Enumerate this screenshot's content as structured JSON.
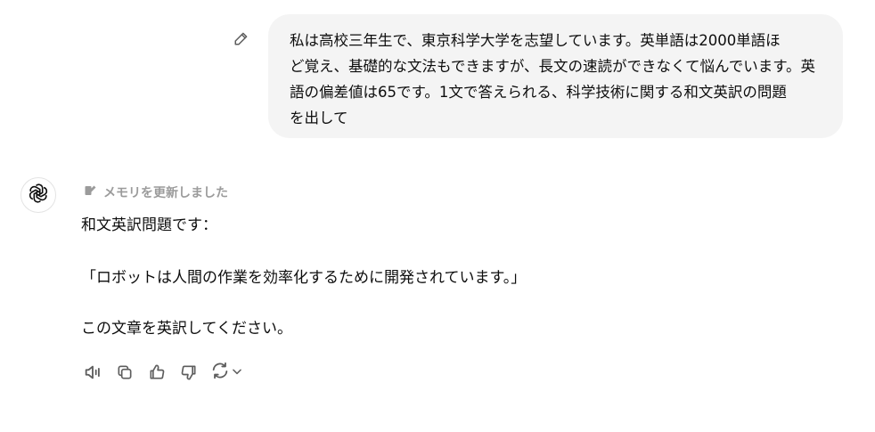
{
  "user_message": {
    "lines": [
      "私は高校三年生で、東京科学大学を志望しています。英単語は2000単語ほ",
      "ど覚え、基礎的な文法もできますが、長文の速読ができなくて悩んでいます。英",
      "語の偏差値は65です。1文で答えられる、科学技術に関する和文英訳の問題",
      "を出して"
    ],
    "edit_icon": "pencil-icon"
  },
  "assistant": {
    "avatar_icon": "openai-logo",
    "memory_note": "メモリを更新しました",
    "memory_icon": "memory-edit-icon",
    "lines": {
      "intro": "和文英訳問題です：",
      "problem": "「ロボットは人間の作業を効率化するために開発されています。」",
      "instruction": "この文章を英訳してください。"
    },
    "actions": {
      "read_aloud_icon": "speaker-icon",
      "copy_icon": "copy-icon",
      "good_icon": "thumbs-up-icon",
      "bad_icon": "thumbs-down-icon",
      "regenerate_icon": "refresh-icon",
      "dropdown_icon": "chevron-down-icon"
    }
  },
  "colors": {
    "bubble_bg": "#f4f4f4",
    "text": "#0d0d0d",
    "muted": "#9b9b9b",
    "icon": "#5d5d5d",
    "avatar_border": "#e3e3e3"
  }
}
